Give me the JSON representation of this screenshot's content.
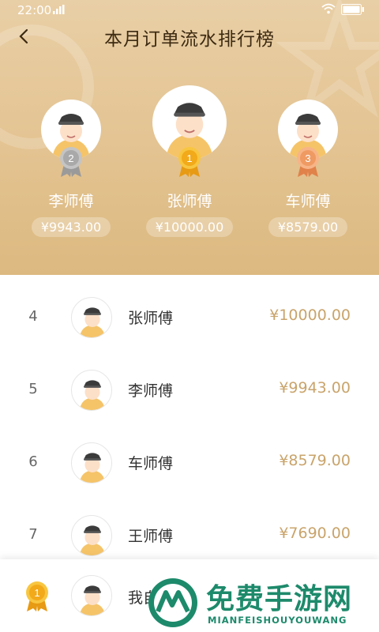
{
  "status_bar": {
    "time": "22:00"
  },
  "header": {
    "title": "本月订单流水排行榜"
  },
  "podium": [
    {
      "rank": "2",
      "name": "李师傅",
      "amount": "¥9943.00"
    },
    {
      "rank": "1",
      "name": "张师傅",
      "amount": "¥10000.00"
    },
    {
      "rank": "3",
      "name": "车师傅",
      "amount": "¥8579.00"
    }
  ],
  "list": [
    {
      "rank": "4",
      "name": "张师傅",
      "amount": "¥10000.00"
    },
    {
      "rank": "5",
      "name": "李师傅",
      "amount": "¥9943.00"
    },
    {
      "rank": "6",
      "name": "车师傅",
      "amount": "¥8579.00"
    },
    {
      "rank": "7",
      "name": "王师傅",
      "amount": "¥7690.00"
    }
  ],
  "me": {
    "rank": "1",
    "name": "我自"
  },
  "watermark": {
    "title": "免费手游网",
    "subtitle": "MIANFEISHOUYOUWANG"
  },
  "colors": {
    "header": "#e3c391",
    "gold": "#f5b51d",
    "silver": "#b9b9b9",
    "bronze": "#f1a36b",
    "amount": "#c9a46b"
  }
}
